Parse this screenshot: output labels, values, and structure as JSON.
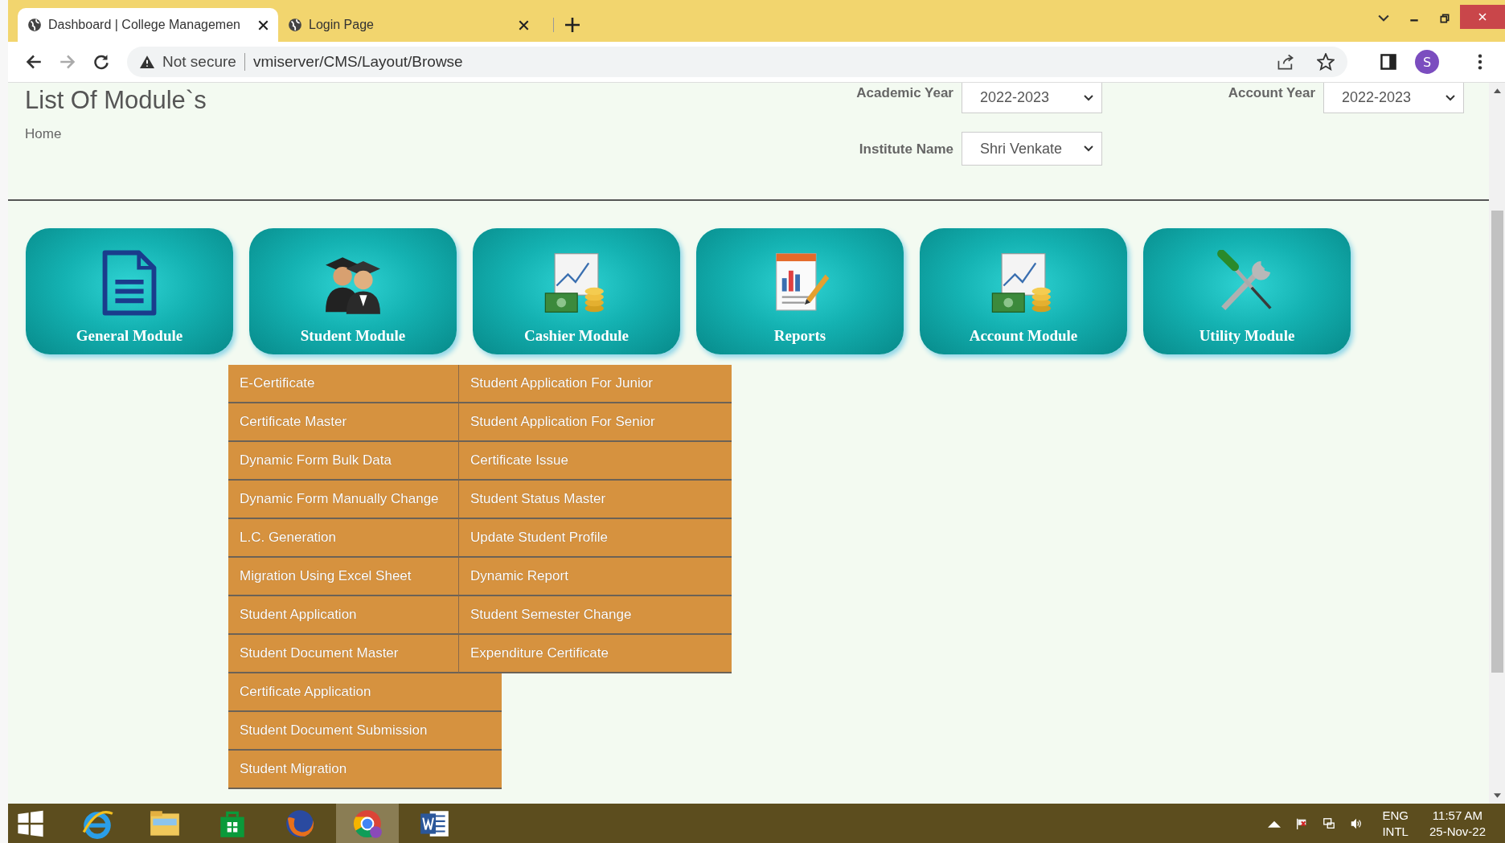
{
  "browser": {
    "tabs": [
      {
        "title": "Dashboard | College Managemen",
        "selected": true
      },
      {
        "title": "Login Page",
        "selected": false
      }
    ],
    "security": "Not secure",
    "url": "vmiserver/CMS/Layout/Browse",
    "profile": "S"
  },
  "page": {
    "title": "List Of Module`s",
    "breadcrumb": "Home",
    "filters": [
      {
        "label": "Academic Year",
        "value": "2022-2023"
      },
      {
        "label": "Account Year",
        "value": "2022-2023"
      },
      {
        "label": "Institute Name",
        "value": "Shri Venkate"
      }
    ]
  },
  "modules": [
    {
      "name": "General Module",
      "kind": "document"
    },
    {
      "name": "Student Module",
      "kind": "students"
    },
    {
      "name": "Cashier Module",
      "kind": "money"
    },
    {
      "name": "Reports",
      "kind": "report"
    },
    {
      "name": "Account Module",
      "kind": "money"
    },
    {
      "name": "Utility Module",
      "kind": "tools"
    }
  ],
  "student_menu": {
    "rows": [
      {
        "items": [
          "E-Certificate",
          "Student Application For Junior"
        ]
      },
      {
        "items": [
          "Certificate Master",
          "Student Application For Senior"
        ]
      },
      {
        "items": [
          "Dynamic Form Bulk Data",
          "Certificate Issue"
        ]
      },
      {
        "items": [
          "Dynamic Form Manually Change",
          "Student Status Master"
        ]
      },
      {
        "items": [
          "L.C. Generation",
          "Update Student Profile"
        ]
      },
      {
        "items": [
          "Migration Using Excel Sheet",
          "Dynamic Report"
        ]
      },
      {
        "items": [
          "Student Application",
          "Student Semester Change"
        ]
      },
      {
        "items": [
          "Student Document Master",
          "Expenditure Certificate"
        ]
      },
      {
        "items": [
          "Certificate Application"
        ]
      },
      {
        "items": [
          "Student Document Submission"
        ]
      },
      {
        "items": [
          "Student Migration"
        ]
      }
    ]
  },
  "taskbar": {
    "apps": [
      {
        "kind": "ie",
        "selected": false
      },
      {
        "kind": "explorer",
        "selected": false
      },
      {
        "kind": "store",
        "selected": false
      },
      {
        "kind": "firefox",
        "selected": false
      },
      {
        "kind": "chrome",
        "selected": true
      },
      {
        "kind": "word",
        "selected": false
      }
    ],
    "language": "ENG",
    "layout": "INTL",
    "time": "11:57 AM",
    "date": "25-Nov-22"
  }
}
